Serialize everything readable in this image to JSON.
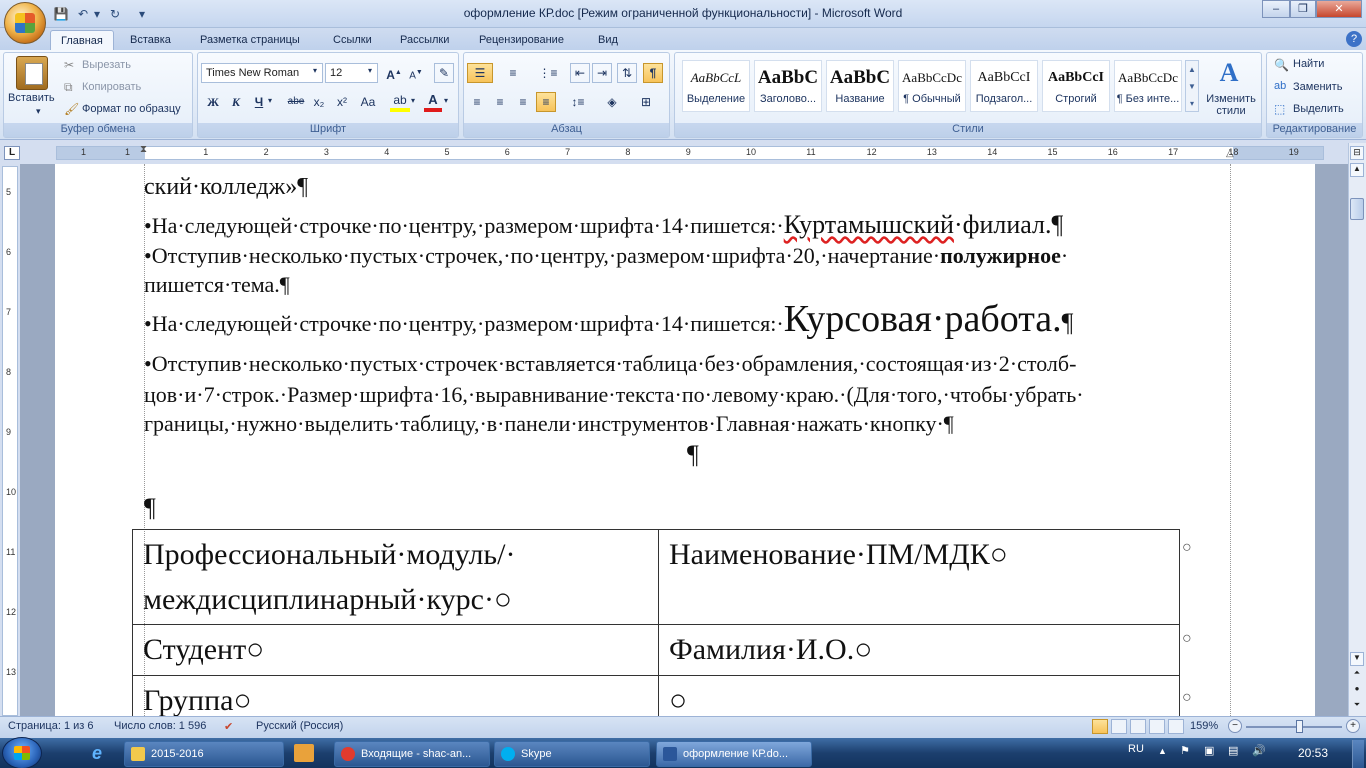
{
  "window": {
    "title": "оформление КР.doc [Режим ограниченной функциональности] - Microsoft Word",
    "minimize": "–",
    "maximize": "❐",
    "close": "✕"
  },
  "ribbon": {
    "tabs": [
      "Главная",
      "Вставка",
      "Разметка страницы",
      "Ссылки",
      "Рассылки",
      "Рецензирование",
      "Вид"
    ],
    "clipboard": {
      "paste": "Вставить",
      "cut": "Вырезать",
      "copy": "Копировать",
      "format_painter": "Формат по образцу",
      "label": "Буфер обмена"
    },
    "font": {
      "name": "Times New Roman",
      "size": "12",
      "bold": "Ж",
      "italic": "К",
      "underline": "Ч",
      "strike": "abe",
      "subscript": "x₂",
      "superscript": "x²",
      "case": "Aa",
      "label": "Шрифт"
    },
    "paragraph": {
      "label": "Абзац",
      "pilcrow": "¶"
    },
    "styles": {
      "items": [
        {
          "sample": "AaBbCcL",
          "name": "Выделение"
        },
        {
          "sample": "AaBbC",
          "name": "Заголово..."
        },
        {
          "sample": "AaBbC",
          "name": "Название"
        },
        {
          "sample": "AaBbCcDc",
          "name": "¶ Обычный"
        },
        {
          "sample": "AaBbCcI",
          "name": "Подзагол..."
        },
        {
          "sample": "AaBbCcI",
          "name": "Строгий"
        },
        {
          "sample": "AaBbCcDc",
          "name": "¶ Без инте..."
        }
      ],
      "change_styles": "Изменить стили",
      "label": "Стили"
    },
    "editing": {
      "find": "Найти",
      "replace": "Заменить",
      "select": "Выделить",
      "label": "Редактирование"
    }
  },
  "ruler": {
    "numbers": [
      "1",
      "1",
      "1",
      "2",
      "3",
      "4",
      "5",
      "6",
      "7",
      "8",
      "9",
      "10",
      "11",
      "12",
      "13",
      "14",
      "15",
      "16",
      "17",
      "18",
      "19"
    ],
    "vnumbers": [
      "5",
      "6",
      "7",
      "8",
      "9",
      "10",
      "11",
      "12",
      "13"
    ]
  },
  "document": {
    "line0": "ский·колледж»¶",
    "line1_prefix": "•На·следующей·строчке·по·центру,·размером·шрифта·14·пишется:·",
    "line1_wave": "Куртамышский",
    "line1_suffix": "·филиал.¶",
    "line2_prefix": "•Отступив·несколько·пустых·строчек,·по·центру,·размером·шрифта·20,·начертание·",
    "line2_bold": "полужирное",
    "line2_suffix": "·",
    "line3": "пишется·тема.¶",
    "line4_prefix": "•На·следующей·строчке·по·центру,·размером·шрифта·14·пишется:·",
    "line4_big": "Курсовая·работа.",
    "line4_pilcrow": "¶",
    "line5": "•Отступив·несколько·пустых·строчек·вставляется·таблица·без·обрамления,·состоящая·из·2·столб-",
    "line6": "цов·и·7·строк.·Размер·шрифта·16,·выравнивание·текста·по·левому·краю.·(Для·того,·чтобы·убрать·",
    "line7": "границы,·нужно·выделить·таблицу,·в·панели·инструментов·Главная·нажать·кнопку·¶",
    "pilcrow_center": "¶",
    "pilcrow_left": "¶",
    "table": [
      [
        "Профессиональный·модуль/· междисциплинарный·курс·○",
        "Наименование·ПМ/МДК○"
      ],
      [
        "Студент○",
        "Фамилия·И.О.○"
      ],
      [
        "Группа○",
        "○"
      ]
    ],
    "row_marks": [
      "○",
      "○",
      "○"
    ]
  },
  "status": {
    "page": "Страница: 1 из 6",
    "words": "Число слов: 1 596",
    "language": "Русский (Россия)",
    "zoom": "159%"
  },
  "taskbar": {
    "items": [
      "2015-2016",
      "Входящие - shac-an...",
      "Skype",
      "оформление КР.do..."
    ],
    "lang": "RU",
    "time": "20:53"
  }
}
